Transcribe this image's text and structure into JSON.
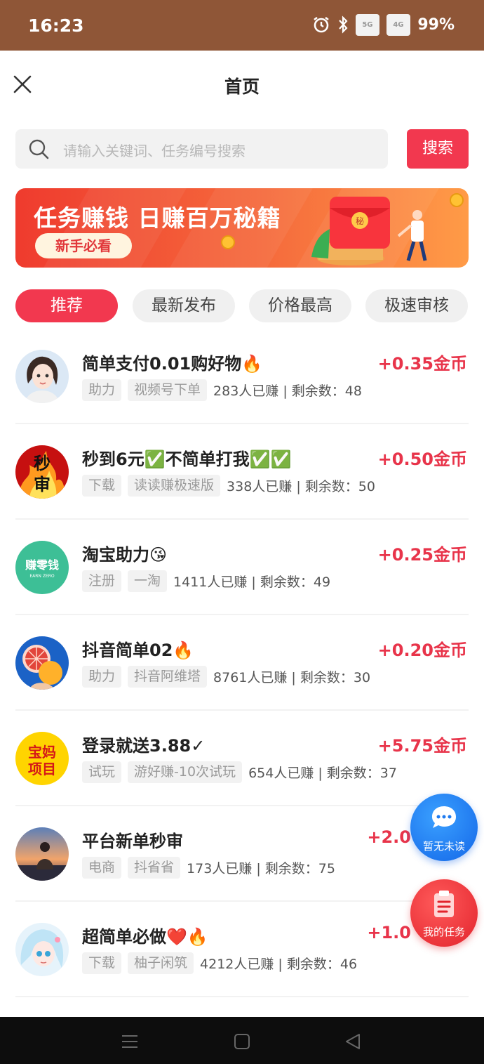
{
  "status_bar": {
    "time": "16:23",
    "network_1": "5G",
    "network_2": "4G",
    "battery": "99%"
  },
  "header": {
    "title": "首页",
    "close_icon": "close-icon"
  },
  "search": {
    "placeholder": "请输入关键词、任务编号搜索",
    "button_label": "搜索"
  },
  "banner": {
    "headline": "任务赚钱  日赚百万秘籍",
    "pill_label": "新手必看",
    "envelope_char": "秘"
  },
  "tabs": [
    {
      "label": "推荐",
      "active": true
    },
    {
      "label": "最新发布",
      "active": false
    },
    {
      "label": "价格最高",
      "active": false
    },
    {
      "label": "极速审核",
      "active": false
    }
  ],
  "tasks": [
    {
      "title": "简单支付0.01购好物🔥",
      "reward": "+0.35金币",
      "tags": [
        "助力",
        "视频号下单"
      ],
      "stats": "283人已赚 | 剩余数：48"
    },
    {
      "title": "秒到6元✅不简单打我✅✅",
      "reward": "+0.50金币",
      "tags": [
        "下载",
        "读读赚极速版"
      ],
      "stats": "338人已赚 | 剩余数：50",
      "avatar_text": [
        "秒",
        "审"
      ]
    },
    {
      "title": "淘宝助力😘",
      "reward": "+0.25金币",
      "tags": [
        "注册",
        "一淘"
      ],
      "stats": "1411人已赚 | 剩余数：49",
      "avatar_text": [
        "赚零钱",
        "EARN ZERO"
      ]
    },
    {
      "title": "抖音简单02🔥",
      "reward": "+0.20金币",
      "tags": [
        "助力",
        "抖音阿维塔"
      ],
      "stats": "8761人已赚 | 剩余数：30"
    },
    {
      "title": "登录就送3.88✓",
      "reward": "+5.75金币",
      "tags": [
        "试玩",
        "游好赚-10次试玩"
      ],
      "stats": "654人已赚 | 剩余数：37",
      "avatar_text": [
        "宝妈",
        "项目"
      ]
    },
    {
      "title": "平台新单秒审",
      "reward": "+2.0",
      "tags": [
        "电商",
        "抖省省"
      ],
      "stats": "173人已赚 | 剩余数：75"
    },
    {
      "title": "超简单必做❤️🔥",
      "reward": "+1.0",
      "tags": [
        "下载",
        "柚子闲筑"
      ],
      "stats": "4212人已赚 | 剩余数：46"
    }
  ],
  "floating": {
    "chat_label": "暂无未读",
    "task_label": "我的任务"
  },
  "colors": {
    "accent": "#f2384f",
    "reward": "#e8344a",
    "status_bar": "#8f5637",
    "chat_fab": "#1f7bf0",
    "task_fab": "#e2232c"
  }
}
